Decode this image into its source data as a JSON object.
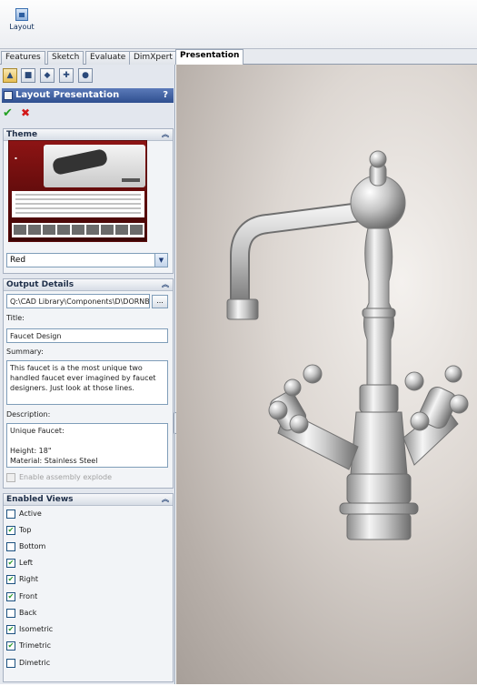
{
  "toolbar": {
    "layout_label": "Layout"
  },
  "tabs": [
    {
      "label": "Features"
    },
    {
      "label": "Sketch"
    },
    {
      "label": "Evaluate"
    },
    {
      "label": "DimXpert"
    },
    {
      "label": "Presentation"
    }
  ],
  "panel": {
    "title": "Layout Presentation",
    "help": "?",
    "ok": "✔",
    "cancel": "✖",
    "theme": {
      "header": "Theme",
      "selected": "Red"
    },
    "output": {
      "header": "Output Details",
      "path": "Q:\\CAD Library\\Components\\D\\DORNBR/",
      "browse": "...",
      "title_label": "Title:",
      "title_value": "Faucet Design",
      "summary_label": "Summary:",
      "summary_value": "This faucet is a the most unique two handled faucet ever imagined by faucet designers. Just look at those lines.",
      "description_label": "Description:",
      "description_value": "Unique Faucet:\n\nHeight: 18\"\nMaterial: Stainless Steel",
      "explode_label": "Enable assembly explode"
    },
    "views": {
      "header": "Enabled Views",
      "items": [
        {
          "label": "Active",
          "checked": false
        },
        {
          "label": "Top",
          "checked": true
        },
        {
          "label": "Bottom",
          "checked": false
        },
        {
          "label": "Left",
          "checked": true
        },
        {
          "label": "Right",
          "checked": true
        },
        {
          "label": "Front",
          "checked": true
        },
        {
          "label": "Back",
          "checked": false
        },
        {
          "label": "Isometric",
          "checked": true
        },
        {
          "label": "Trimetric",
          "checked": true
        },
        {
          "label": "Dimetric",
          "checked": false
        }
      ]
    }
  },
  "colors": {
    "accent": "#2f4f8f",
    "checkmark": "#2a9b2a",
    "cancel": "#d21818",
    "theme_preview": "#8d1414"
  }
}
